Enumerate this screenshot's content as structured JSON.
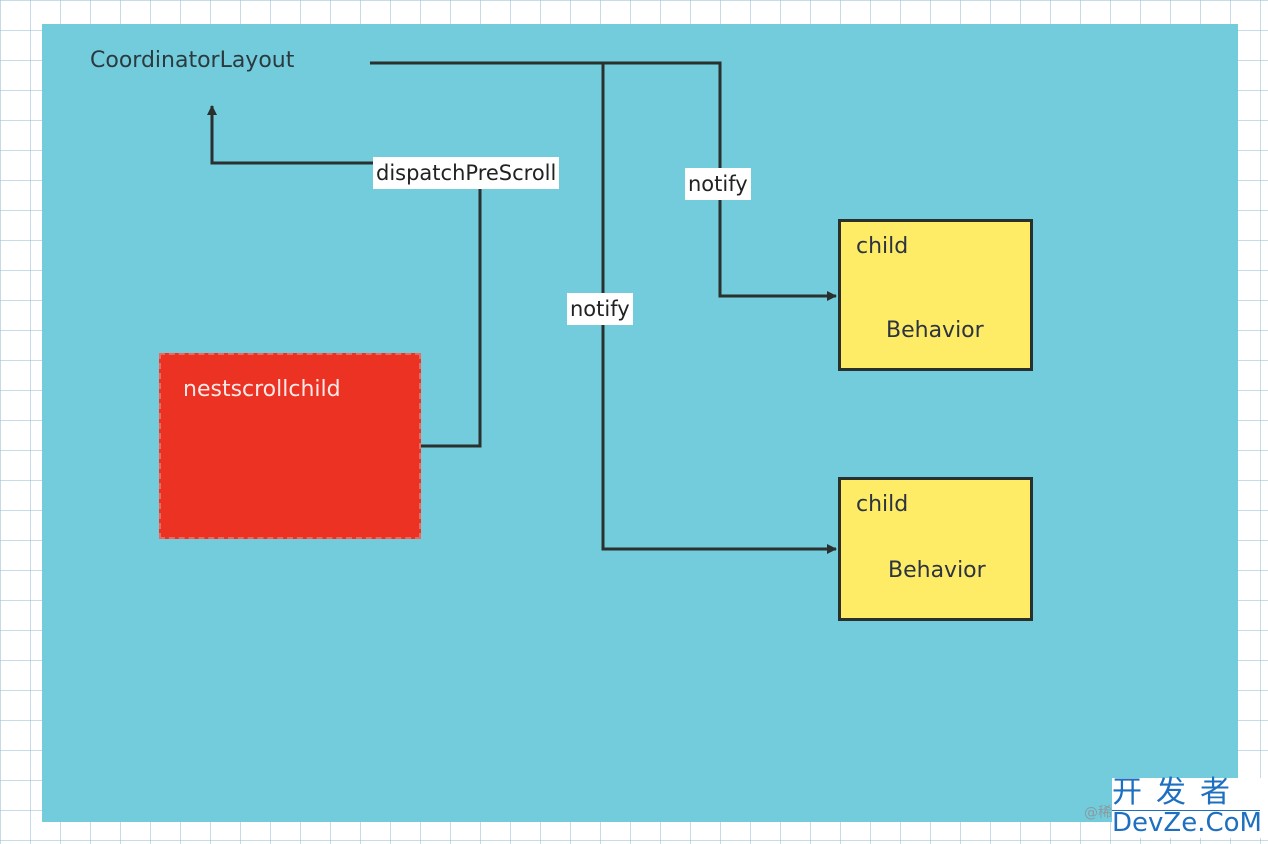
{
  "diagram": {
    "title": "CoordinatorLayout",
    "nodes": {
      "coordinator": {
        "label": "CoordinatorLayout"
      },
      "nested_scroll_child": {
        "label": "nestscrollchild",
        "color": "#EB3223"
      },
      "child_1": {
        "label": "child",
        "sublabel": "Behavior",
        "color": "#FEEB66"
      },
      "child_2": {
        "label": "child",
        "sublabel": "Behavior",
        "color": "#FEEB66"
      }
    },
    "edges": [
      {
        "from": "nestscrollchild",
        "to": "CoordinatorLayout",
        "label": "dispatchPreScroll"
      },
      {
        "from": "CoordinatorLayout",
        "to": "child_1",
        "label": "notify"
      },
      {
        "from": "CoordinatorLayout",
        "to": "child_2",
        "label": "notify"
      }
    ],
    "background_color": "#72CCDC"
  },
  "watermark": {
    "at_text": "@稀",
    "cn_text": "开发者",
    "en_text": "DevZe.CoM"
  }
}
